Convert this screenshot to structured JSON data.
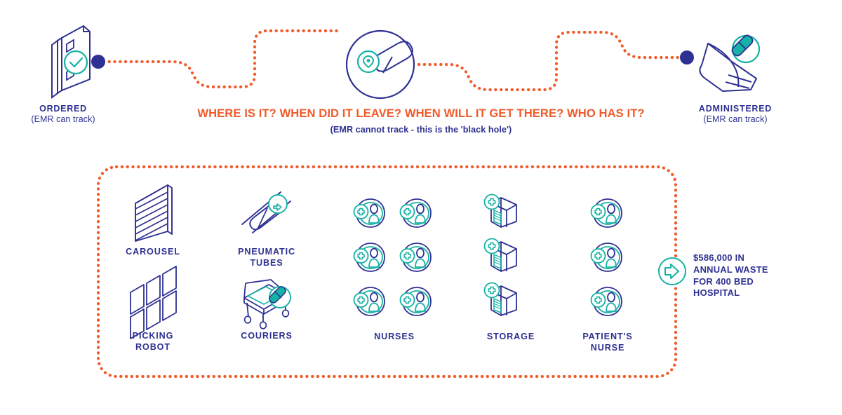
{
  "flow": {
    "start": {
      "icon": "clipboard-check-icon",
      "title": "ORDERED",
      "subtitle": "(EMR can track)"
    },
    "middle": {
      "icon": "pill-location-pin-icon"
    },
    "end": {
      "icon": "hand-pill-icon",
      "title": "ADMINISTERED",
      "subtitle": "(EMR can track)"
    }
  },
  "headline": {
    "questions": "WHERE IS IT? WHEN DID IT LEAVE? WHEN WILL IT GET THERE? WHO HAS IT?",
    "note": "(EMR cannot track - this is the 'black hole')"
  },
  "blackbox": {
    "columns": [
      {
        "label": "CAROUSEL",
        "icon": "carousel-shelf-icon",
        "count": 1
      },
      {
        "label": "PNEUMATIC\nTUBES",
        "label_line1": "PNEUMATIC",
        "label_line2": "TUBES",
        "icon": "pneumatic-tube-icon",
        "count": 1
      },
      {
        "label": "PICKING\nROBOT",
        "label_line1": "PICKING",
        "label_line2": "ROBOT",
        "icon": "picking-robot-icon",
        "count": 1
      },
      {
        "label": "COURIERS",
        "icon": "courier-cart-icon",
        "count": 1
      },
      {
        "label": "NURSES",
        "icon": "nurse-icon",
        "count": 6
      },
      {
        "label": "STORAGE",
        "icon": "storage-warehouse-icon",
        "count": 3
      },
      {
        "label": "PATIENT'S\nNURSE",
        "label_line1": "PATIENT'S",
        "label_line2": "NURSE",
        "icon": "patient-nurse-icon",
        "count": 3
      }
    ]
  },
  "outcome": {
    "icon": "arrow-right-circle-icon",
    "line1": "$586,000 IN",
    "line2": "ANNUAL WASTE",
    "line3": "FOR 400 BED",
    "line4": "HOSPITAL"
  },
  "colors": {
    "navy": "#2e3192",
    "orange": "#f15a29",
    "teal": "#16b2a6",
    "background": "#ffffff"
  }
}
